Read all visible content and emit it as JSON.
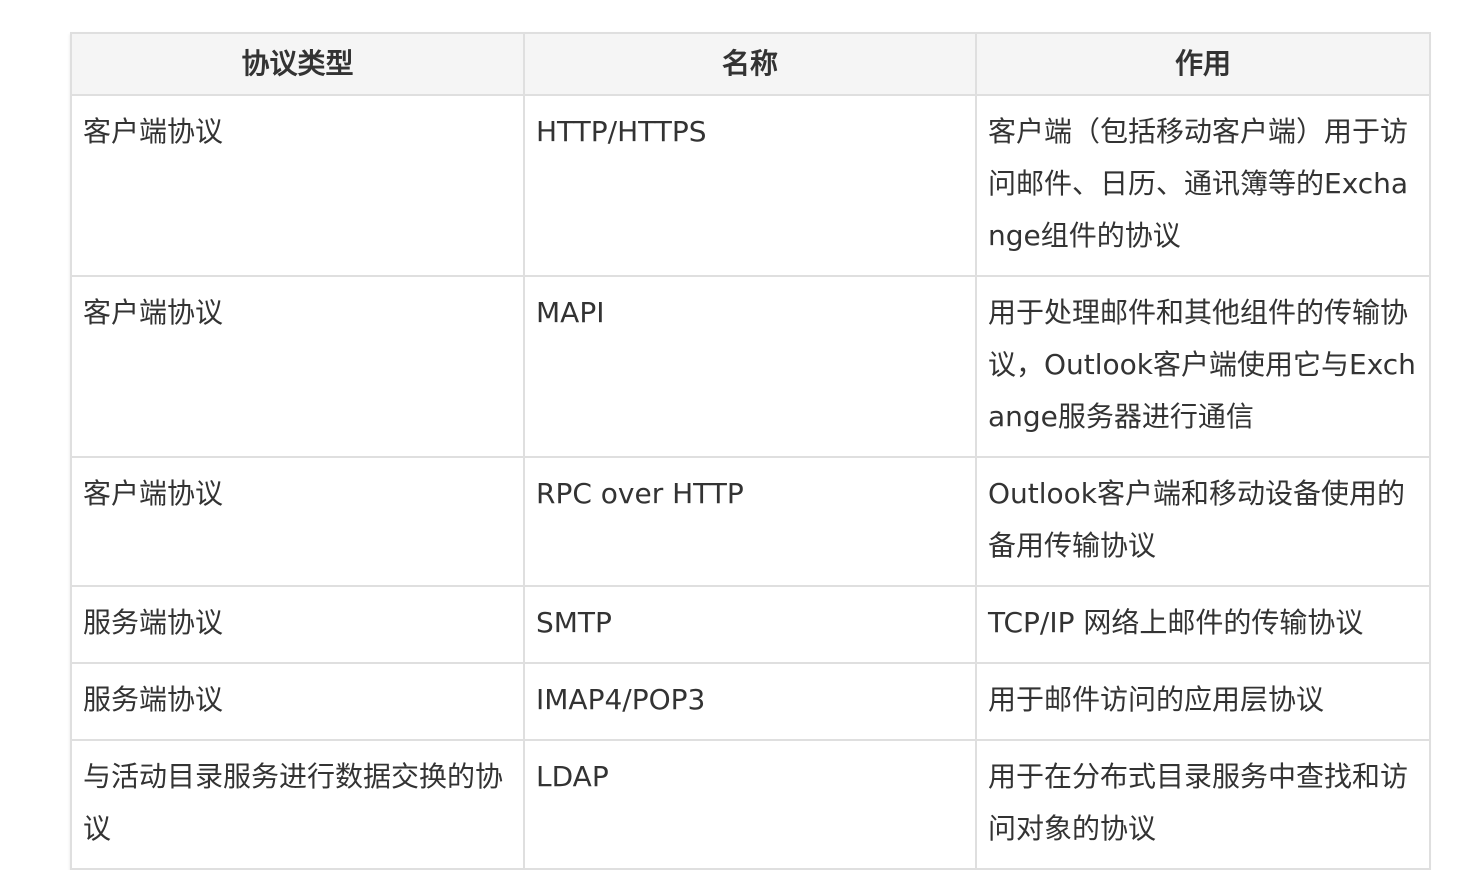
{
  "table": {
    "headers": [
      "协议类型",
      "名称",
      "作用"
    ],
    "rows": [
      {
        "type": "客户端协议",
        "name": "HTTP/HTTPS",
        "purpose": "客户端（包括移动客户端）用于访问邮件、日历、通讯簿等的Exchange组件的协议"
      },
      {
        "type": "客户端协议",
        "name": "MAPI",
        "purpose": "用于处理邮件和其他组件的传输协议，Outlook客户端使用它与Exchange服务器进行通信"
      },
      {
        "type": "客户端协议",
        "name": "RPC over HTTP",
        "purpose": "Outlook客户端和移动设备使用的备用传输协议"
      },
      {
        "type": "服务端协议",
        "name": "SMTP",
        "purpose": "TCP/IP 网络上邮件的传输协议"
      },
      {
        "type": "服务端协议",
        "name": "IMAP4/POP3",
        "purpose": "用于邮件访问的应用层协议"
      },
      {
        "type": "与活动目录服务进行数据交换的协议",
        "name": "LDAP",
        "purpose": "用于在分布式目录服务中查找和访问对象的协议"
      }
    ]
  },
  "colors": {
    "header_bg": "#f5f5f5",
    "border": "#dfdfdf",
    "text": "#333333"
  }
}
